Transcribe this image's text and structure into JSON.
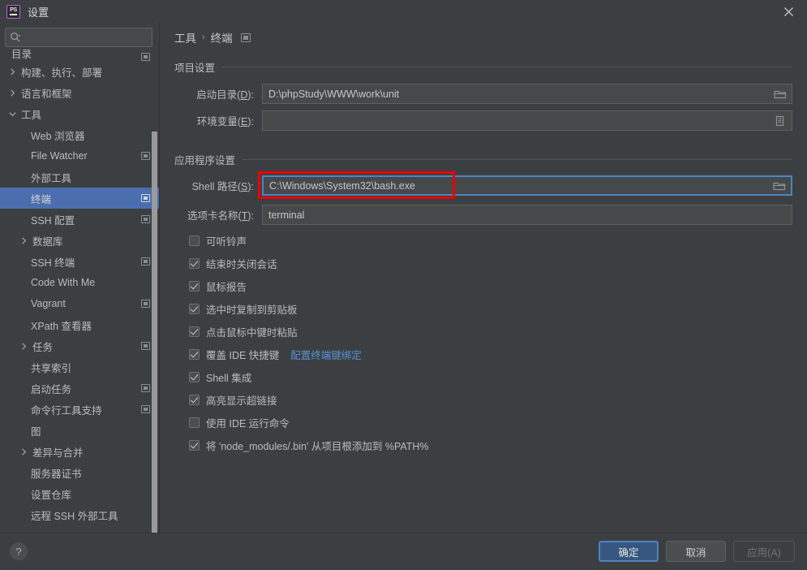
{
  "window": {
    "title": "设置",
    "app_icon_text": "PS",
    "close_label": "×"
  },
  "sidebar": {
    "search": {
      "value": "",
      "placeholder": ""
    },
    "items": [
      {
        "label": "目录",
        "indent": 14,
        "arrow": "none",
        "scope": true,
        "selected": false,
        "clipped": true
      },
      {
        "label": "构建、执行、部署",
        "indent": 10,
        "arrow": "right",
        "scope": false,
        "selected": false
      },
      {
        "label": "语言和框架",
        "indent": 10,
        "arrow": "right",
        "scope": false,
        "selected": false
      },
      {
        "label": "工具",
        "indent": 10,
        "arrow": "down",
        "scope": false,
        "selected": false
      },
      {
        "label": "Web 浏览器",
        "indent": 38,
        "arrow": "none",
        "scope": false,
        "selected": false
      },
      {
        "label": "File Watcher",
        "indent": 38,
        "arrow": "none",
        "scope": true,
        "selected": false
      },
      {
        "label": "外部工具",
        "indent": 38,
        "arrow": "none",
        "scope": false,
        "selected": false
      },
      {
        "label": "终端",
        "indent": 38,
        "arrow": "none",
        "scope": true,
        "selected": true
      },
      {
        "label": "SSH 配置",
        "indent": 38,
        "arrow": "none",
        "scope": true,
        "selected": false
      },
      {
        "label": "数据库",
        "indent": 24,
        "arrow": "right",
        "scope": false,
        "selected": false
      },
      {
        "label": "SSH 终端",
        "indent": 38,
        "arrow": "none",
        "scope": true,
        "selected": false
      },
      {
        "label": "Code With Me",
        "indent": 38,
        "arrow": "none",
        "scope": false,
        "selected": false
      },
      {
        "label": "Vagrant",
        "indent": 38,
        "arrow": "none",
        "scope": true,
        "selected": false
      },
      {
        "label": "XPath 查看器",
        "indent": 38,
        "arrow": "none",
        "scope": false,
        "selected": false
      },
      {
        "label": "任务",
        "indent": 24,
        "arrow": "right",
        "scope": true,
        "selected": false
      },
      {
        "label": "共享索引",
        "indent": 38,
        "arrow": "none",
        "scope": false,
        "selected": false
      },
      {
        "label": "启动任务",
        "indent": 38,
        "arrow": "none",
        "scope": true,
        "selected": false
      },
      {
        "label": "命令行工具支持",
        "indent": 38,
        "arrow": "none",
        "scope": true,
        "selected": false
      },
      {
        "label": "图",
        "indent": 38,
        "arrow": "none",
        "scope": false,
        "selected": false
      },
      {
        "label": "差异与合并",
        "indent": 24,
        "arrow": "right",
        "scope": false,
        "selected": false
      },
      {
        "label": "服务器证书",
        "indent": 38,
        "arrow": "none",
        "scope": false,
        "selected": false
      },
      {
        "label": "设置仓库",
        "indent": 38,
        "arrow": "none",
        "scope": false,
        "selected": false
      },
      {
        "label": "远程 SSH 外部工具",
        "indent": 38,
        "arrow": "none",
        "scope": false,
        "selected": false
      }
    ]
  },
  "breadcrumb": {
    "root": "工具",
    "separator": "›",
    "current": "终端"
  },
  "main": {
    "project_section": {
      "title": "项目设置",
      "fields": [
        {
          "label_prefix": "启动目录(",
          "mnemonic": "D",
          "label_suffix": "):",
          "value": "D:\\phpStudy\\WWW\\work\\unit",
          "button_icon": "folder-icon"
        },
        {
          "label_prefix": "环境变量(",
          "mnemonic": "E",
          "label_suffix": "):",
          "value": "",
          "button_icon": "document-icon"
        }
      ]
    },
    "app_section": {
      "title": "应用程序设置",
      "fields": [
        {
          "label_prefix": "Shell 路径(",
          "mnemonic": "S",
          "label_suffix": "):",
          "value": "C:\\Windows\\System32\\bash.exe",
          "button_icon": "folder-icon",
          "focused": true,
          "highlighted": true
        },
        {
          "label_prefix": "选项卡名称(",
          "mnemonic": "T",
          "label_suffix": "):",
          "value": "terminal",
          "button_icon": "none"
        }
      ]
    },
    "checkboxes": [
      {
        "label": "可听铃声",
        "checked": false
      },
      {
        "label": "结束时关闭会话",
        "checked": true
      },
      {
        "label": "鼠标报告",
        "checked": true
      },
      {
        "label": "选中时复制到剪贴板",
        "checked": true
      },
      {
        "label": "点击鼠标中键时粘贴",
        "checked": true
      },
      {
        "label": "覆盖 IDE 快捷键",
        "checked": true,
        "link": "配置终端键绑定"
      },
      {
        "label": "Shell 集成",
        "checked": true
      },
      {
        "label": "高亮显示超链接",
        "checked": true
      },
      {
        "label": "使用 IDE 运行命令",
        "checked": false
      },
      {
        "label": "将 'node_modules/.bin' 从项目根添加到 %PATH%",
        "checked": true
      }
    ]
  },
  "footer": {
    "help_label": "?",
    "ok_label": "确定",
    "cancel_label": "取消",
    "apply_label": "应用(A)"
  },
  "colors": {
    "background": "#3c3f41",
    "selection_blue": "#4b6eaf",
    "focus_blue": "#4d84c5",
    "annotation_red": "#ee0000",
    "link_blue": "#5892d6",
    "primary_button": "#365880"
  }
}
